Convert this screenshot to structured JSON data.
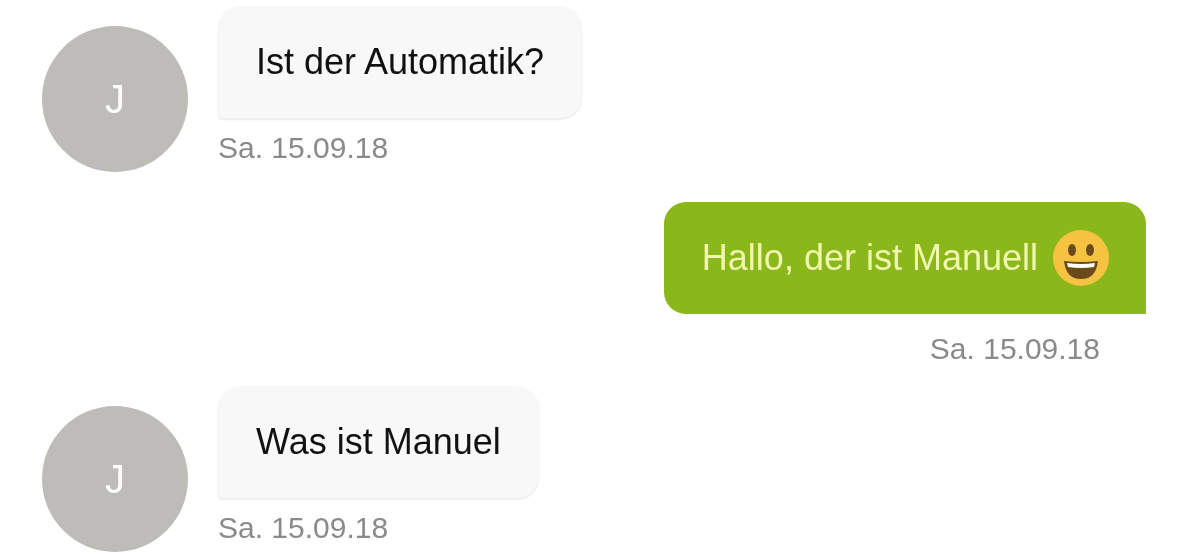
{
  "messages": [
    {
      "kind": "incoming",
      "avatar": "J",
      "text": "Ist der Automatik?",
      "date": "Sa. 15.09.18",
      "emoji": false
    },
    {
      "kind": "outgoing",
      "text": "Hallo, der ist Manuell",
      "date": "Sa. 15.09.18",
      "emoji": true
    },
    {
      "kind": "incoming",
      "avatar": "J",
      "text": "Was ist Manuel",
      "date": "Sa. 15.09.18",
      "emoji": false
    }
  ]
}
